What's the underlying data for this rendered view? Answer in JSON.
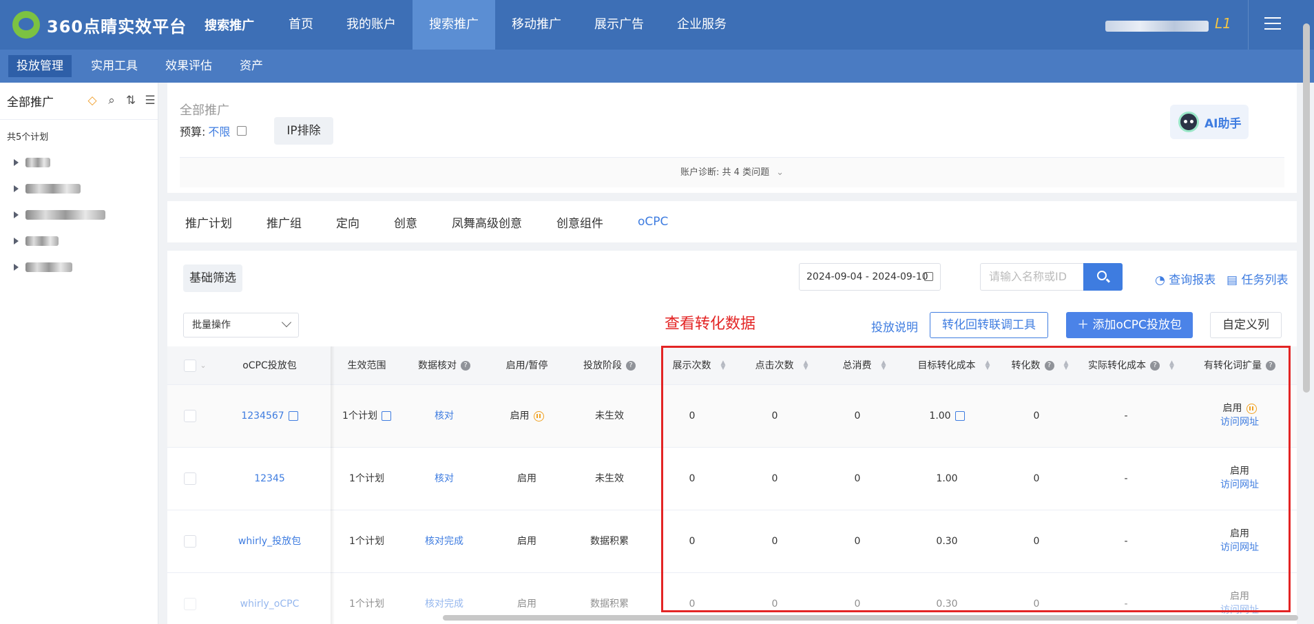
{
  "header": {
    "logo_text": "360点睛实效平台",
    "logo_sub": "搜索推广",
    "nav": [
      {
        "label": "首页",
        "active": false
      },
      {
        "label": "我的账户",
        "active": false
      },
      {
        "label": "搜索推广",
        "active": true
      },
      {
        "label": "移动推广",
        "active": false
      },
      {
        "label": "展示广告",
        "active": false
      },
      {
        "label": "企业服务",
        "active": false
      }
    ],
    "level": "L1"
  },
  "subnav": [
    "投放管理",
    "实用工具",
    "效果评估",
    "资产"
  ],
  "sidebar": {
    "title": "全部推广",
    "count": "共5个计划"
  },
  "overview": {
    "title": "全部推广",
    "budget_label": "预算:",
    "budget_value": "不限",
    "ip_button": "IP排除",
    "ai_button": "AI助手",
    "diagnosis": "账户诊断: 共 4 类问题"
  },
  "tabs": [
    "推广计划",
    "推广组",
    "定向",
    "创意",
    "凤舞高级创意",
    "创意组件",
    "oCPC"
  ],
  "toolbar": {
    "basic_filter": "基础筛选",
    "date_range": "2024-09-04 - 2024-09-10",
    "search_placeholder": "请输入名称或ID",
    "query_report": "查询报表",
    "task_list": "任务列表",
    "batch_ops": "批量操作",
    "annotation": "查看转化数据",
    "explain_link": "投放说明",
    "tool_button": "转化回转联调工具",
    "add_button": "添加oCPC投放包",
    "custom_columns": "自定义列"
  },
  "table": {
    "headers": [
      "oCPC投放包",
      "生效范围",
      "数据核对",
      "启用/暂停",
      "投放阶段",
      "展示次数",
      "点击次数",
      "总消费",
      "目标转化成本",
      "转化数",
      "实际转化成本",
      "有转化词扩量"
    ],
    "rows": [
      {
        "name": "1234567",
        "scope": "1个计划",
        "check": "核对",
        "status": "启用",
        "stage": "未生效",
        "impressions": "0",
        "clicks": "0",
        "cost": "0",
        "target_cost": "1.00",
        "conversions": "0",
        "actual_cost": "-",
        "expand": "启用",
        "visit": "访问网址"
      },
      {
        "name": "12345",
        "scope": "1个计划",
        "check": "核对",
        "status": "启用",
        "stage": "未生效",
        "impressions": "0",
        "clicks": "0",
        "cost": "0",
        "target_cost": "1.00",
        "conversions": "0",
        "actual_cost": "-",
        "expand": "启用",
        "visit": "访问网址"
      },
      {
        "name": "whirly_投放包",
        "scope": "1个计划",
        "check": "核对完成",
        "status": "启用",
        "stage": "数据积累",
        "impressions": "0",
        "clicks": "0",
        "cost": "0",
        "target_cost": "0.30",
        "conversions": "0",
        "actual_cost": "-",
        "expand": "启用",
        "visit": "访问网址"
      },
      {
        "name": "whirly_oCPC",
        "scope": "1个计划",
        "check": "核对完成",
        "status": "启用",
        "stage": "数据积累",
        "impressions": "0",
        "clicks": "0",
        "cost": "0",
        "target_cost": "0.30",
        "conversions": "0",
        "actual_cost": "-",
        "expand": "启用",
        "visit": "访问网址"
      }
    ]
  }
}
